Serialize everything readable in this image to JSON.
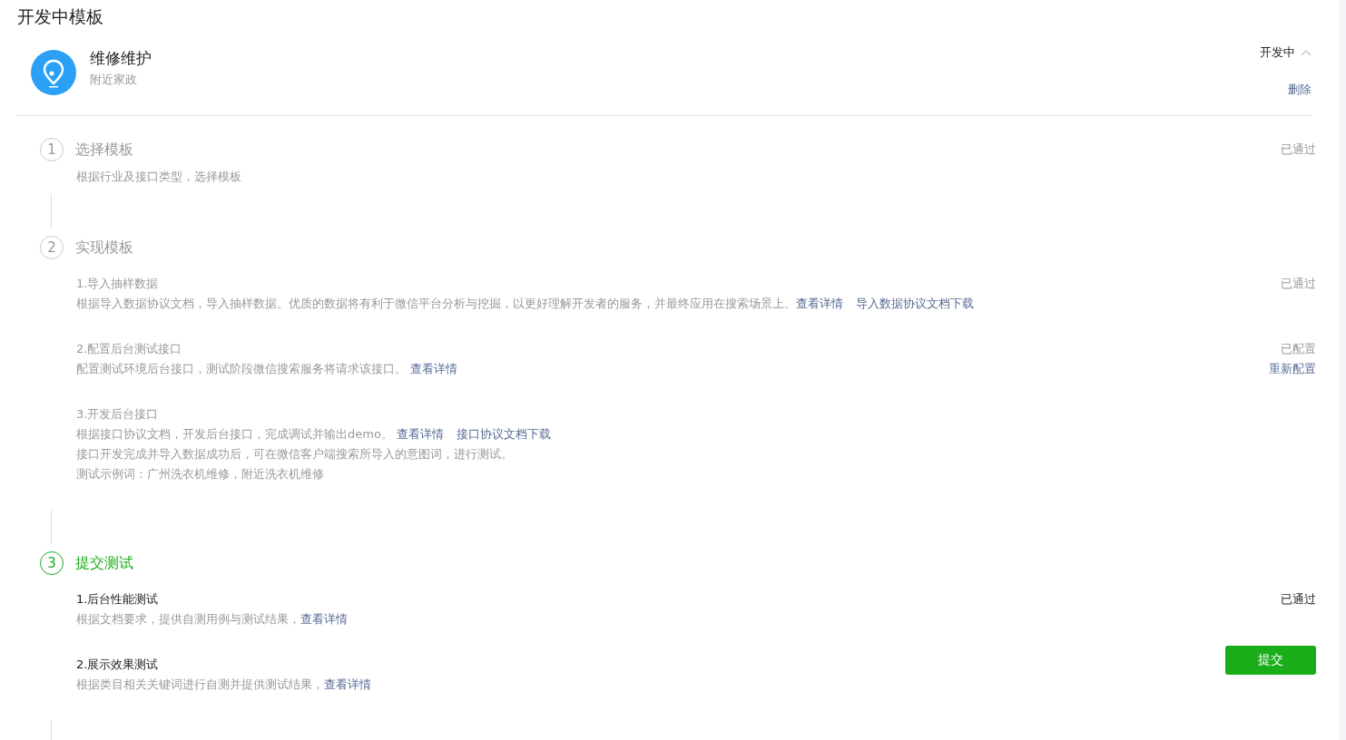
{
  "page_title": "开发中模板",
  "template": {
    "name": "维修维护",
    "category": "附近家政",
    "status": "开发中",
    "expanded": true,
    "delete_label": "删除"
  },
  "steps": [
    {
      "number": "1",
      "title": "选择模板",
      "active": false,
      "status": "已通过",
      "description": "根据行业及接口类型，选择模板"
    },
    {
      "number": "2",
      "title": "实现模板",
      "active": false,
      "tasks": [
        {
          "title": "1.导入抽样数据",
          "status": "已通过",
          "lines": [
            {
              "text": "根据导入数据协议文档，导入抽样数据。优质的数据将有利于微信平台分析与挖掘，以更好理解开发者的服务，并最终应用在搜索场景上。",
              "links": [
                "查看详情",
                "导入数据协议文档下载"
              ]
            }
          ]
        },
        {
          "title": "2.配置后台测试接口",
          "status": "已配置",
          "status_link": "重新配置",
          "lines": [
            {
              "text": "配置测试环境后台接口，测试阶段微信搜索服务将请求该接口。 ",
              "links": [
                "查看详情"
              ]
            }
          ]
        },
        {
          "title": "3.开发后台接口",
          "lines": [
            {
              "text": "根据接口协议文档，开发后台接口，完成调试并输出demo。 ",
              "links": [
                "查看详情",
                "接口协议文档下载"
              ]
            },
            {
              "text": "接口开发完成并导入数据成功后，可在微信客户端搜索所导入的意图词，进行测试。"
            },
            {
              "text": "测试示例词：广州洗衣机维修，附近洗衣机维修"
            }
          ]
        }
      ]
    },
    {
      "number": "3",
      "title": "提交测试",
      "active": true,
      "tasks": [
        {
          "title": "1.后台性能测试",
          "status": "已通过",
          "lines": [
            {
              "text": "根据文档要求，提供自测用例与测试结果，",
              "links": [
                "查看详情"
              ]
            }
          ]
        },
        {
          "title": "2.展示效果测试",
          "button": "提交",
          "lines": [
            {
              "text": "根据类目相关关键词进行自测并提供测试结果，",
              "links": [
                "查看详情"
              ]
            }
          ]
        }
      ]
    }
  ]
}
